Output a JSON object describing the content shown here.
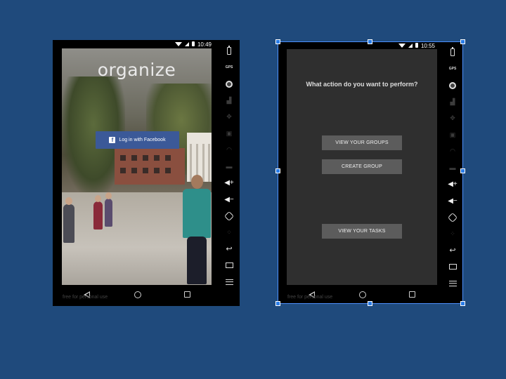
{
  "left_phone": {
    "status_time": "10:49",
    "app_title": "organize",
    "facebook_button": "Log in with Facebook",
    "watermark": "free for personal use"
  },
  "right_phone": {
    "status_time": "10:55",
    "question": "What action do you want to perform?",
    "buttons": [
      "VIEW YOUR GROUPS",
      "CREATE GROUP",
      "VIEW YOUR TASKS"
    ],
    "watermark": "free for personal use"
  },
  "emulator_controls": [
    "battery-icon",
    "gps-icon",
    "camera-icon",
    "signal-icon",
    "dpad-icon",
    "id-icon",
    "rss-icon",
    "sms-icon",
    "volume-up-icon",
    "volume-down-icon",
    "rotate-icon",
    "dots-icon",
    "back-icon",
    "recents-icon",
    "menu-icon"
  ],
  "colors": {
    "slide_background": "#1f4a7c",
    "facebook_blue": "#3b5998",
    "app_background": "#2f2f2f",
    "button_gray": "#5c5c5c",
    "selection_blue": "#4d90fe"
  }
}
